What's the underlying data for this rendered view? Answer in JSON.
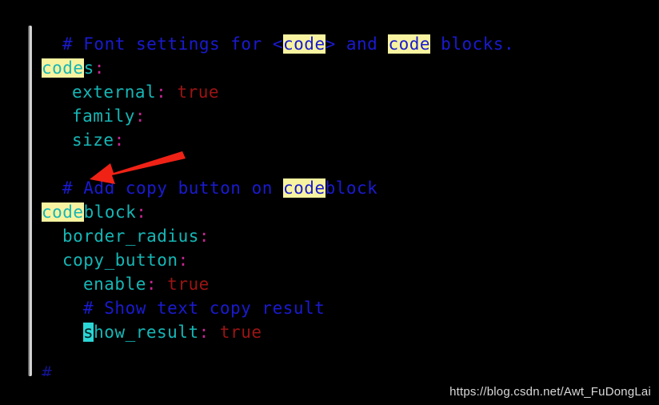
{
  "editor": {
    "background": "#000000",
    "comment_color": "#1a1ad0",
    "key_color": "#16b6b6",
    "punctuation_color": "#c2268f",
    "value_color": "#9c1414",
    "highlight_color": "#f7f3a0",
    "cursor_color": "#2bd6d6",
    "scrollbar_color": "#e8e8e8",
    "lines": [
      {
        "id": "line-1-comment-font-settings",
        "segments": [
          {
            "text": "# Font settings for <",
            "style": "cmt"
          },
          {
            "text": "code",
            "style": "hl-cmt"
          },
          {
            "text": "> and ",
            "style": "cmt"
          },
          {
            "text": "code",
            "style": "hl-cmt"
          },
          {
            "text": " blocks.",
            "style": "cmt"
          }
        ]
      },
      {
        "id": "line-2-codes-key",
        "segments": [
          {
            "text": "code",
            "style": "hl-key"
          },
          {
            "text": "s",
            "style": "key"
          },
          {
            "text": ":",
            "style": "colon"
          }
        ]
      },
      {
        "id": "line-3-external",
        "segments": [
          {
            "text": "external",
            "style": "key"
          },
          {
            "text": ":",
            "style": "colon"
          },
          {
            "text": " ",
            "style": "key"
          },
          {
            "text": "true",
            "style": "val"
          }
        ]
      },
      {
        "id": "line-4-family",
        "segments": [
          {
            "text": "family",
            "style": "key"
          },
          {
            "text": ":",
            "style": "colon"
          }
        ]
      },
      {
        "id": "line-5-size",
        "segments": [
          {
            "text": "size",
            "style": "key"
          },
          {
            "text": ":",
            "style": "colon"
          }
        ]
      },
      {
        "id": "line-6-comment-add-copy-button",
        "segments": [
          {
            "text": "# Add copy button on ",
            "style": "cmt"
          },
          {
            "text": "code",
            "style": "hl-cmt"
          },
          {
            "text": "block",
            "style": "cmt"
          }
        ]
      },
      {
        "id": "line-7-codeblock-key",
        "segments": [
          {
            "text": "code",
            "style": "hl-key"
          },
          {
            "text": "block",
            "style": "key"
          },
          {
            "text": ":",
            "style": "colon"
          }
        ]
      },
      {
        "id": "line-8-border-radius",
        "segments": [
          {
            "text": "border_radius",
            "style": "key"
          },
          {
            "text": ":",
            "style": "colon"
          }
        ]
      },
      {
        "id": "line-9-copy-button",
        "segments": [
          {
            "text": "copy_button",
            "style": "key"
          },
          {
            "text": ":",
            "style": "colon"
          }
        ]
      },
      {
        "id": "line-10-enable",
        "segments": [
          {
            "text": "enable",
            "style": "key"
          },
          {
            "text": ":",
            "style": "colon"
          },
          {
            "text": " ",
            "style": "key"
          },
          {
            "text": "true",
            "style": "val"
          }
        ]
      },
      {
        "id": "line-11-comment-show-text-copy-result",
        "segments": [
          {
            "text": "# Show text copy result",
            "style": "cmt"
          }
        ]
      },
      {
        "id": "line-12-show-result",
        "segments": [
          {
            "text": "s",
            "style": "cursor"
          },
          {
            "text": "how_result",
            "style": "key"
          },
          {
            "text": ":",
            "style": "colon"
          },
          {
            "text": " ",
            "style": "key"
          },
          {
            "text": "true",
            "style": "val"
          }
        ]
      }
    ],
    "clipped_comment_glyph": "#"
  },
  "annotation": {
    "arrow_color": "#f02216",
    "arrow_name": "red-pointer-arrow"
  },
  "watermark": {
    "text": "https://blog.csdn.net/Awt_FuDongLai"
  }
}
